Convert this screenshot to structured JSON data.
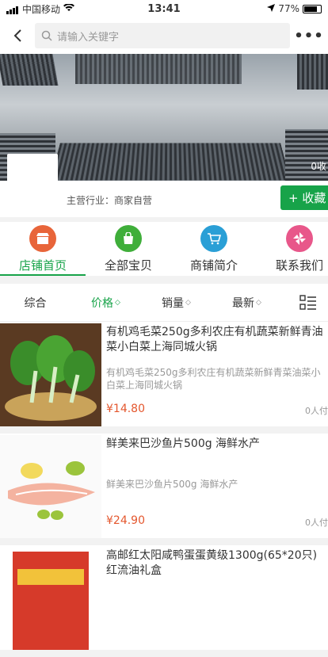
{
  "status_bar": {
    "carrier": "中国移动",
    "time": "13:41",
    "battery": "77%"
  },
  "search": {
    "placeholder": "请输入关键字"
  },
  "banner": {
    "favorites_count": "0收"
  },
  "shop": {
    "industry": "主营行业：商家自营",
    "favorite_label": "+ 收藏"
  },
  "nav": {
    "items": [
      {
        "label": "店铺首页",
        "color": "#e8653a"
      },
      {
        "label": "全部宝贝",
        "color": "#3fae3a"
      },
      {
        "label": "商铺简介",
        "color": "#2a9fd6"
      },
      {
        "label": "联系我们",
        "color": "#e8578a"
      }
    ]
  },
  "sort": {
    "items": [
      "综合",
      "价格",
      "销量",
      "最新"
    ]
  },
  "products": [
    {
      "title": "有机鸡毛菜250g多利农庄有机蔬菜新鲜青油菜小白菜上海同城火锅",
      "desc": "有机鸡毛菜250g多利农庄有机蔬菜新鲜青菜油菜小白菜上海同城火锅",
      "price": "¥14.80",
      "sold": "0人付"
    },
    {
      "title": "鲜美来巴沙鱼片500g 海鲜水产",
      "desc": "鲜美来巴沙鱼片500g 海鲜水产",
      "price": "¥24.90",
      "sold": "0人付"
    },
    {
      "title": "高邮红太阳咸鸭蛋蛋黄级1300g(65*20只)红流油礼盒",
      "desc": "",
      "price": "",
      "sold": ""
    }
  ],
  "colors": {
    "accent": "#17a349",
    "price": "#e4572e"
  }
}
